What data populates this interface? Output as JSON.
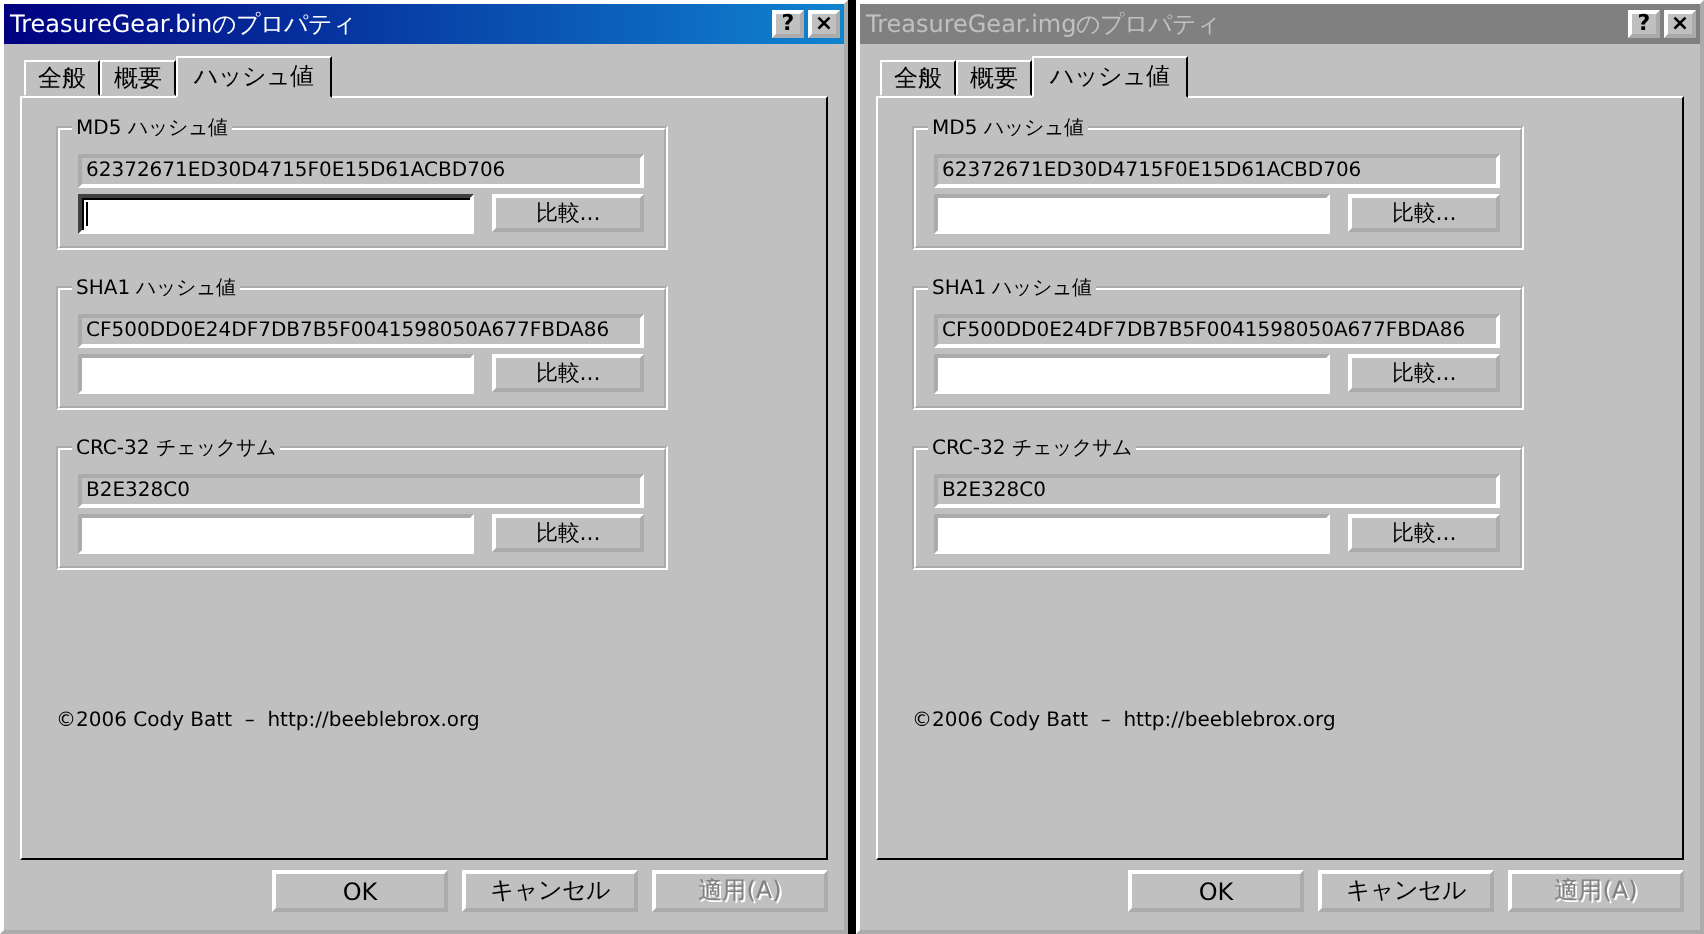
{
  "dialogs": [
    {
      "title": "TreasureGear.binのプロパティ",
      "active": true,
      "title_buttons": [
        "?",
        "×"
      ],
      "tabs": [
        {
          "label": "全般",
          "selected": false
        },
        {
          "label": "概要",
          "selected": false
        },
        {
          "label": "ハッシュ値",
          "selected": true
        }
      ],
      "groups": [
        {
          "label": "MD5 ハッシュ値",
          "hash": "62372671ED30D4715F0E15D61ACBD706",
          "focused": true,
          "compare_button": "比較..."
        },
        {
          "label": "SHA1 ハッシュ値",
          "hash": "CF500DD0E24DF7DB7B5F0041598050A677FBDA86",
          "focused": false,
          "compare_button": "比較..."
        },
        {
          "label": "CRC-32 チェックサム",
          "hash": "B2E328C0",
          "focused": false,
          "compare_button": "比較..."
        }
      ],
      "footer": "©2006 Cody Batt  –  http://beeblebrox.org",
      "buttons": [
        {
          "label": "OK",
          "disabled": false
        },
        {
          "label": "キャンセル",
          "disabled": false
        },
        {
          "label": "適用(A)",
          "disabled": true
        }
      ]
    },
    {
      "title": "TreasureGear.imgのプロパティ",
      "active": false,
      "title_buttons": [
        "?",
        "×"
      ],
      "tabs": [
        {
          "label": "全般",
          "selected": false
        },
        {
          "label": "概要",
          "selected": false
        },
        {
          "label": "ハッシュ値",
          "selected": true
        }
      ],
      "groups": [
        {
          "label": "MD5 ハッシュ値",
          "hash": "62372671ED30D4715F0E15D61ACBD706",
          "focused": false,
          "compare_button": "比較..."
        },
        {
          "label": "SHA1 ハッシュ値",
          "hash": "CF500DD0E24DF7DB7B5F0041598050A677FBDA86",
          "focused": false,
          "compare_button": "比較..."
        },
        {
          "label": "CRC-32 チェックサム",
          "hash": "B2E328C0",
          "focused": false,
          "compare_button": "比較..."
        }
      ],
      "footer": "©2006 Cody Batt  –  http://beeblebrox.org",
      "buttons": [
        {
          "label": "OK",
          "disabled": false
        },
        {
          "label": "キャンセル",
          "disabled": false
        },
        {
          "label": "適用(A)",
          "disabled": true
        }
      ]
    }
  ]
}
